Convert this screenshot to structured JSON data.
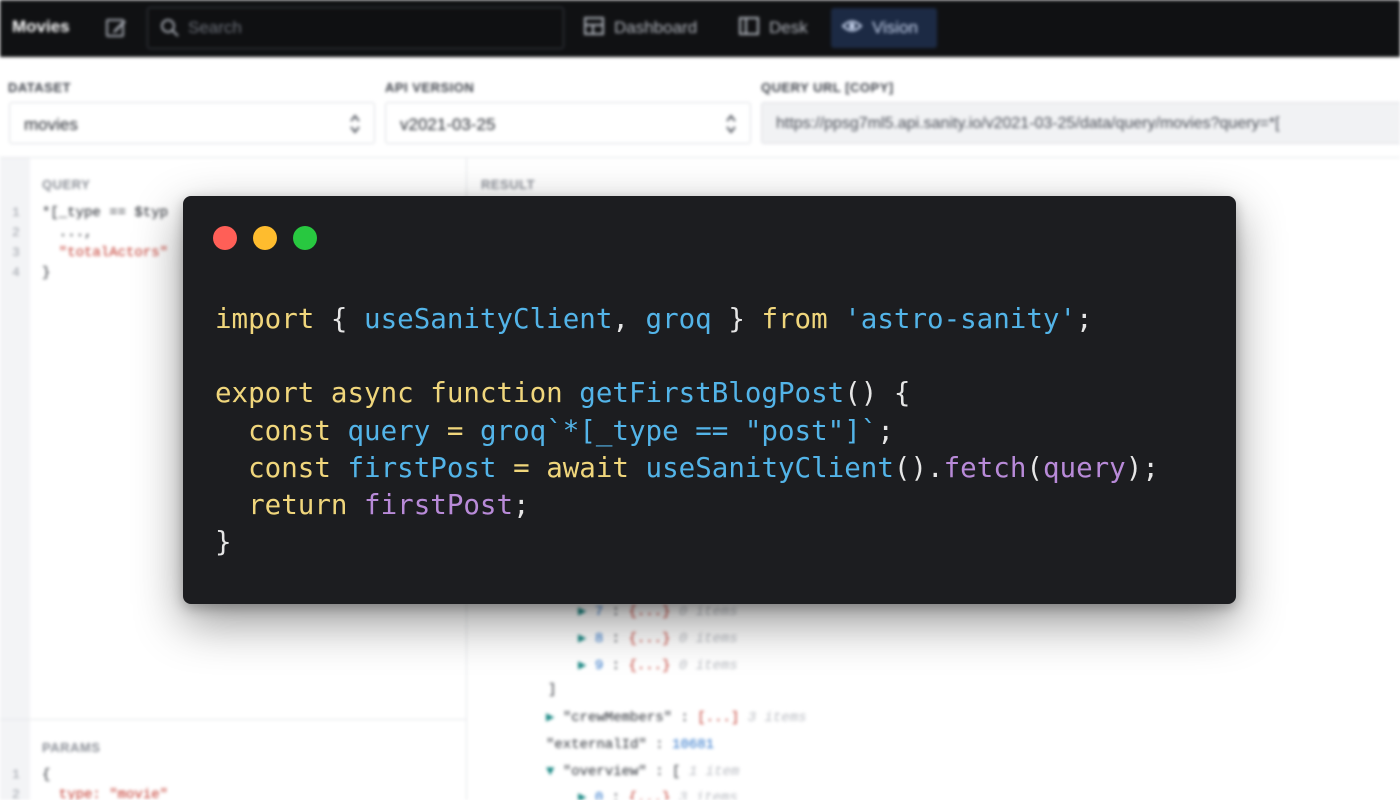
{
  "app": {
    "title": "Movies",
    "search_placeholder": "Search",
    "nav": [
      {
        "label": "Dashboard",
        "icon": "dashboard-icon"
      },
      {
        "label": "Desk",
        "icon": "desk-icon"
      },
      {
        "label": "Vision",
        "icon": "eye-icon",
        "active": true
      }
    ]
  },
  "vision": {
    "dataset": {
      "label": "DATASET",
      "value": "movies"
    },
    "api_version": {
      "label": "API VERSION",
      "value": "v2021-03-25"
    },
    "query_url": {
      "label": "QUERY URL [COPY]",
      "value": "https://ppsg7ml5.api.sanity.io/v2021-03-25/data/query/movies?query=*["
    },
    "query": {
      "title": "QUERY",
      "line_numbers": [
        "1",
        "2",
        "3",
        "4"
      ],
      "lines": [
        "*[_type == $typ",
        "  ...,",
        "  \"totalActors\"",
        "}"
      ]
    },
    "params": {
      "title": "PARAMS",
      "line_numbers": [
        "1",
        "2"
      ],
      "lines": [
        "{",
        "  type: \"movie\""
      ]
    },
    "result": {
      "title": "RESULT",
      "items": [
        {
          "index": "7",
          "collapsed": "{...}",
          "count": "0 items"
        },
        {
          "index": "8",
          "collapsed": "{...}",
          "count": "0 items"
        },
        {
          "index": "9",
          "collapsed": "{...}",
          "count": "0 items"
        }
      ],
      "close_bracket": "]",
      "crew_members": {
        "key": "\"crewMembers\"",
        "collapsed": "[...]",
        "count": "3 items"
      },
      "external_id": {
        "key": "\"externalId\"",
        "value": "10681"
      },
      "overview": {
        "key": "\"overview\"",
        "open": "[",
        "count": "1 item"
      },
      "overview_child": {
        "index": "0",
        "collapsed": "{...}",
        "count": "3 items"
      }
    }
  },
  "code_window": {
    "dot_colors": [
      "#ff5f57",
      "#febc2e",
      "#28c840"
    ],
    "tokens": {
      "import": "import",
      "brace_open": "{",
      "use_sanity_client": "useSanityClient",
      "comma": ",",
      "groq": "groq",
      "brace_close": "}",
      "from": "from",
      "module": "'astro-sanity'",
      "semicolon": ";",
      "export": "export",
      "async": "async",
      "function": "function",
      "fn_name": "getFirstBlogPost",
      "parens": "()",
      "const": "const",
      "query": "query",
      "equals": "=",
      "groq_template": "`*[_type == \"post\"]`",
      "first_post": "firstPost",
      "await": "await",
      "call_parens": "()",
      "dot": ".",
      "fetch": "fetch",
      "paren_open": "(",
      "paren_close": ")",
      "return": "return"
    }
  }
}
